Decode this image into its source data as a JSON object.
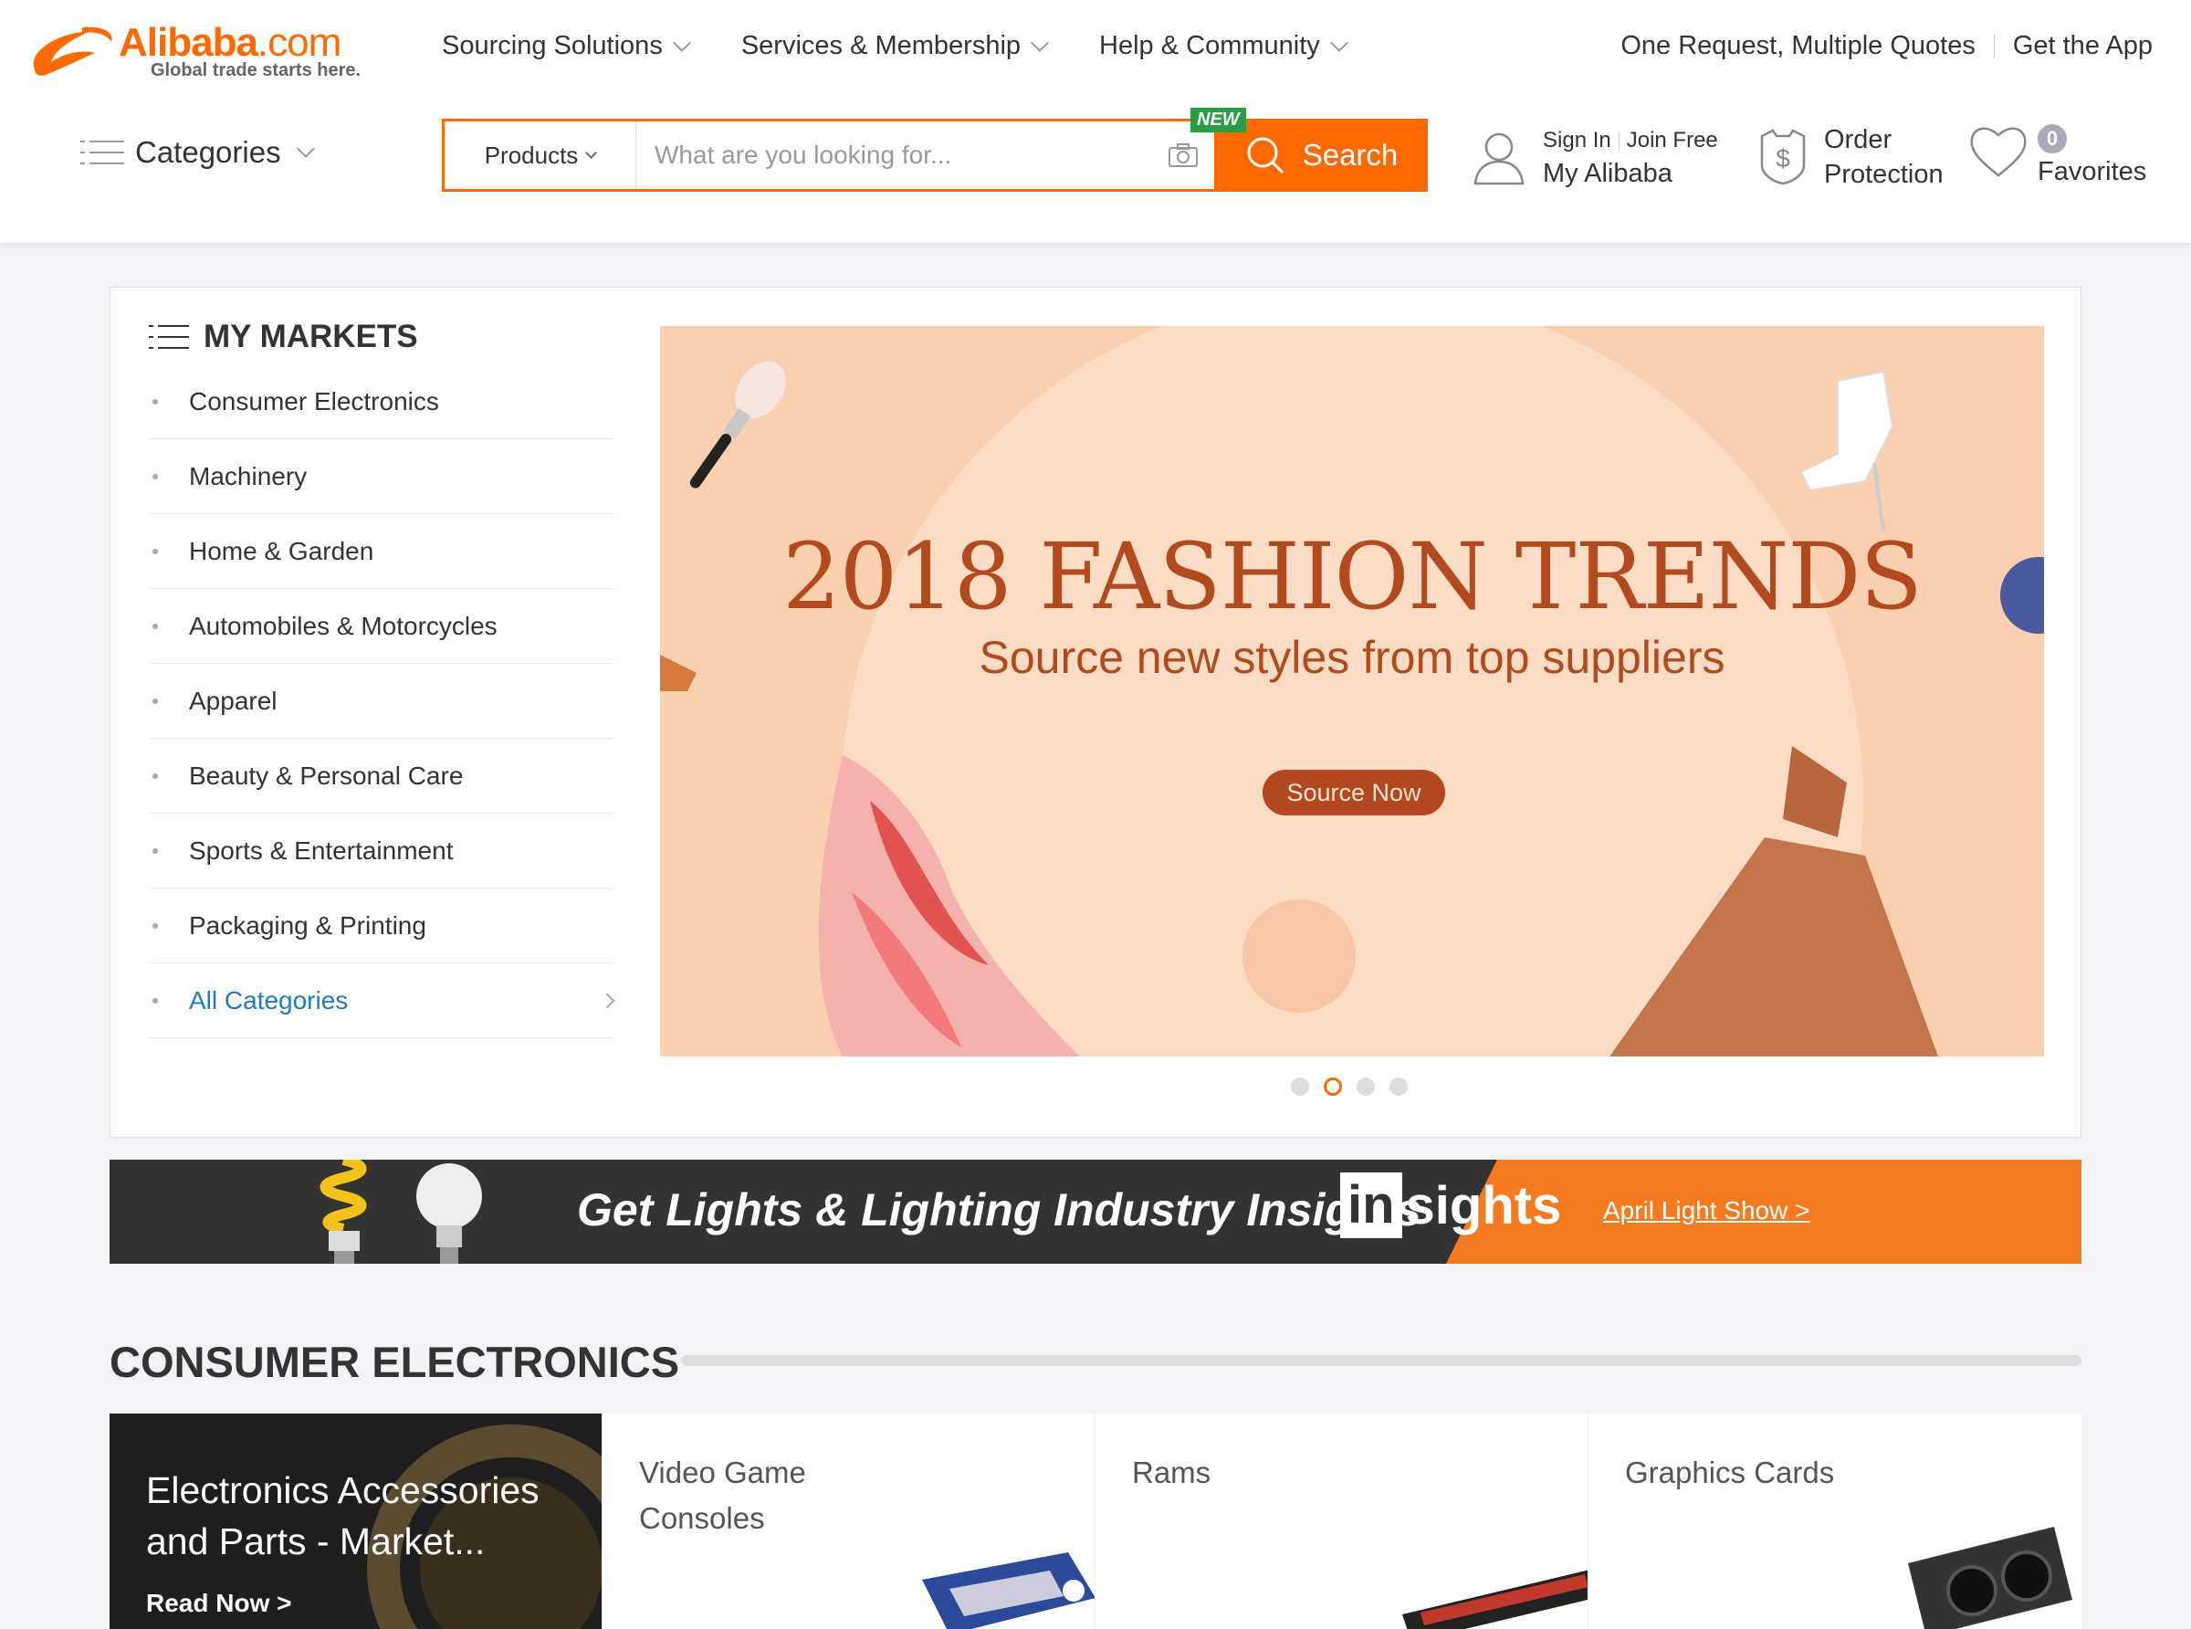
{
  "brand": {
    "logo_text": "Alibaba",
    "logo_suffix": ".com",
    "tagline": "Global trade starts here."
  },
  "topnav": {
    "items": [
      "Sourcing Solutions",
      "Services & Membership",
      "Help & Community"
    ],
    "right": [
      "One Request, Multiple Quotes",
      "Get the App"
    ]
  },
  "categories_label": "Categories",
  "search": {
    "category": "Products",
    "placeholder": "What are you looking for...",
    "button": "Search",
    "new_badge": "NEW"
  },
  "user": {
    "sign_in": "Sign In",
    "join": "Join Free",
    "my_alibaba": "My Alibaba"
  },
  "order_protection": {
    "line1": "Order",
    "line2": "Protection"
  },
  "favorites": {
    "label": "Favorites",
    "count": "0"
  },
  "my_markets": {
    "title": "MY MARKETS",
    "items": [
      "Consumer Electronics",
      "Machinery",
      "Home & Garden",
      "Automobiles & Motorcycles",
      "Apparel",
      "Beauty & Personal Care",
      "Sports & Entertainment",
      "Packaging & Printing"
    ],
    "all": "All Categories"
  },
  "banner": {
    "headline": "2018 FASHION TRENDS",
    "subheadline": "Source new styles from top suppliers",
    "cta": "Source Now",
    "slides": 4,
    "active_slide": 2
  },
  "insights": {
    "text": "Get Lights & Lighting Industry Insights",
    "logo_in": "in",
    "logo_rest": "sights",
    "link": "April Light Show >"
  },
  "consumer_electronics": {
    "title": "CONSUMER ELECTRONICS",
    "feature": {
      "title": "Electronics Accessories and Parts - Market...",
      "link": "Read Now >"
    },
    "cards": [
      "Video Game Consoles",
      "Rams",
      "Graphics Cards"
    ]
  },
  "colors": {
    "accent": "#ff6a00",
    "link": "#1f7cc1",
    "banner_bg": "#fbd0b1",
    "banner_text": "#b24a1d",
    "insights_dark": "#333333",
    "insights_orange": "#f47b20"
  }
}
